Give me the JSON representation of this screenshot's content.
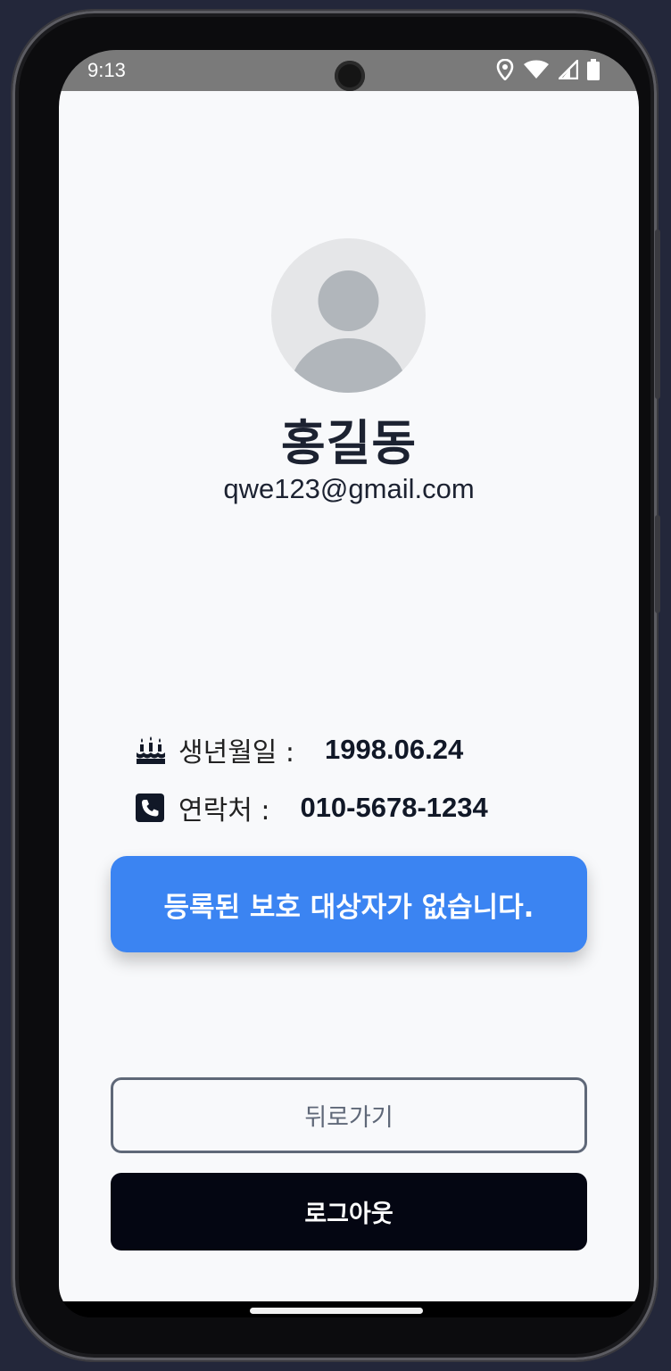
{
  "status_bar": {
    "time": "9:13",
    "icons": [
      "location-icon",
      "wifi-icon",
      "signal-icon",
      "battery-icon"
    ]
  },
  "profile": {
    "name": "홍길동",
    "email": "qwe123@gmail.com"
  },
  "info": {
    "birthday": {
      "icon": "cake-icon",
      "label": "생년월일 :",
      "value": "1998.06.24"
    },
    "phone": {
      "icon": "phone-icon",
      "label": "연락처 :",
      "value": "010-5678-1234"
    }
  },
  "notice": {
    "text": "등록된 보호 대상자가 없습니다.",
    "color": "#3b84f2"
  },
  "buttons": {
    "back_label": "뒤로가기",
    "logout_label": "로그아웃"
  },
  "colors": {
    "background": "#f8f9fb",
    "text": "#1c2231",
    "logout_bg": "#040612",
    "back_border": "#5f6878"
  }
}
